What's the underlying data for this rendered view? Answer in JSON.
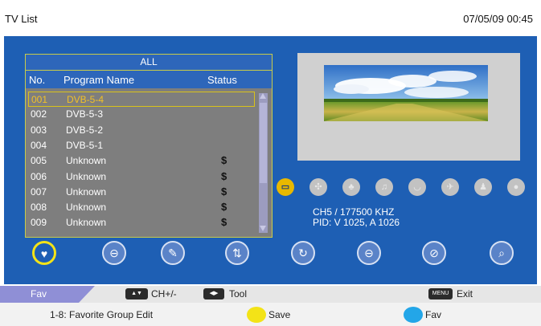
{
  "header": {
    "title": "TV List",
    "datetime": "07/05/09 00:45"
  },
  "list": {
    "group": "ALL",
    "columns": {
      "no": "No.",
      "name": "Program Name",
      "status": "Status"
    },
    "rows": [
      {
        "no": "001",
        "name": "DVB-5-4",
        "status": "",
        "selected": true
      },
      {
        "no": "002",
        "name": "DVB-5-3",
        "status": ""
      },
      {
        "no": "003",
        "name": "DVB-5-2",
        "status": ""
      },
      {
        "no": "004",
        "name": "DVB-5-1",
        "status": ""
      },
      {
        "no": "005",
        "name": "Unknown",
        "status": "$"
      },
      {
        "no": "006",
        "name": "Unknown",
        "status": "$"
      },
      {
        "no": "007",
        "name": "Unknown",
        "status": "$"
      },
      {
        "no": "008",
        "name": "Unknown",
        "status": "$"
      },
      {
        "no": "009",
        "name": "Unknown",
        "status": "$"
      }
    ]
  },
  "preview": {
    "alt_icon": "landscape-preview-image"
  },
  "categories": [
    {
      "icon": "film-category-icon",
      "glyph": "▭",
      "active": true
    },
    {
      "icon": "sports-category-icon",
      "glyph": "✣"
    },
    {
      "icon": "kids-category-icon",
      "glyph": "♣"
    },
    {
      "icon": "music-category-icon",
      "glyph": "♫"
    },
    {
      "icon": "cooking-category-icon",
      "glyph": "◡"
    },
    {
      "icon": "travel-category-icon",
      "glyph": "✈"
    },
    {
      "icon": "culture-category-icon",
      "glyph": "♟"
    },
    {
      "icon": "person-category-icon",
      "glyph": "●"
    }
  ],
  "channel_info": {
    "line1": "CH5 / 177500  KHZ",
    "line2": "PID: V 1025, A 1026"
  },
  "function_buttons": [
    {
      "name": "favorite-button",
      "icon": "heart-icon",
      "glyph": "♥",
      "active": true
    },
    {
      "name": "lock-button",
      "icon": "lock-icon",
      "glyph": "⊖"
    },
    {
      "name": "rename-button",
      "icon": "pencil-icon",
      "glyph": "✎"
    },
    {
      "name": "move-button",
      "icon": "sort-arrows-icon",
      "glyph": "⇅"
    },
    {
      "name": "skip-button",
      "icon": "recycle-icon",
      "glyph": "↻"
    },
    {
      "name": "delete-button",
      "icon": "delete-icon",
      "glyph": "⊖"
    },
    {
      "name": "block-button",
      "icon": "block-icon",
      "glyph": "⊘"
    },
    {
      "name": "find-button",
      "icon": "search-icon",
      "glyph": "⌕"
    }
  ],
  "bottom": {
    "mode_tab": "Fav",
    "ch_key": "▲▼",
    "ch_label": "CH+/-",
    "tool_key": "◀▶",
    "tool_label": "Tool",
    "menu_key": "MENU",
    "menu_label": "Exit",
    "hint": "1-8: Favorite  Group  Edit",
    "yellow_label": "Save",
    "blue_label": "Fav"
  },
  "colors": {
    "background": "#1e5fb4",
    "selected": "#f0c028",
    "yellow": "#f3e317",
    "blue": "#23a6e8"
  }
}
